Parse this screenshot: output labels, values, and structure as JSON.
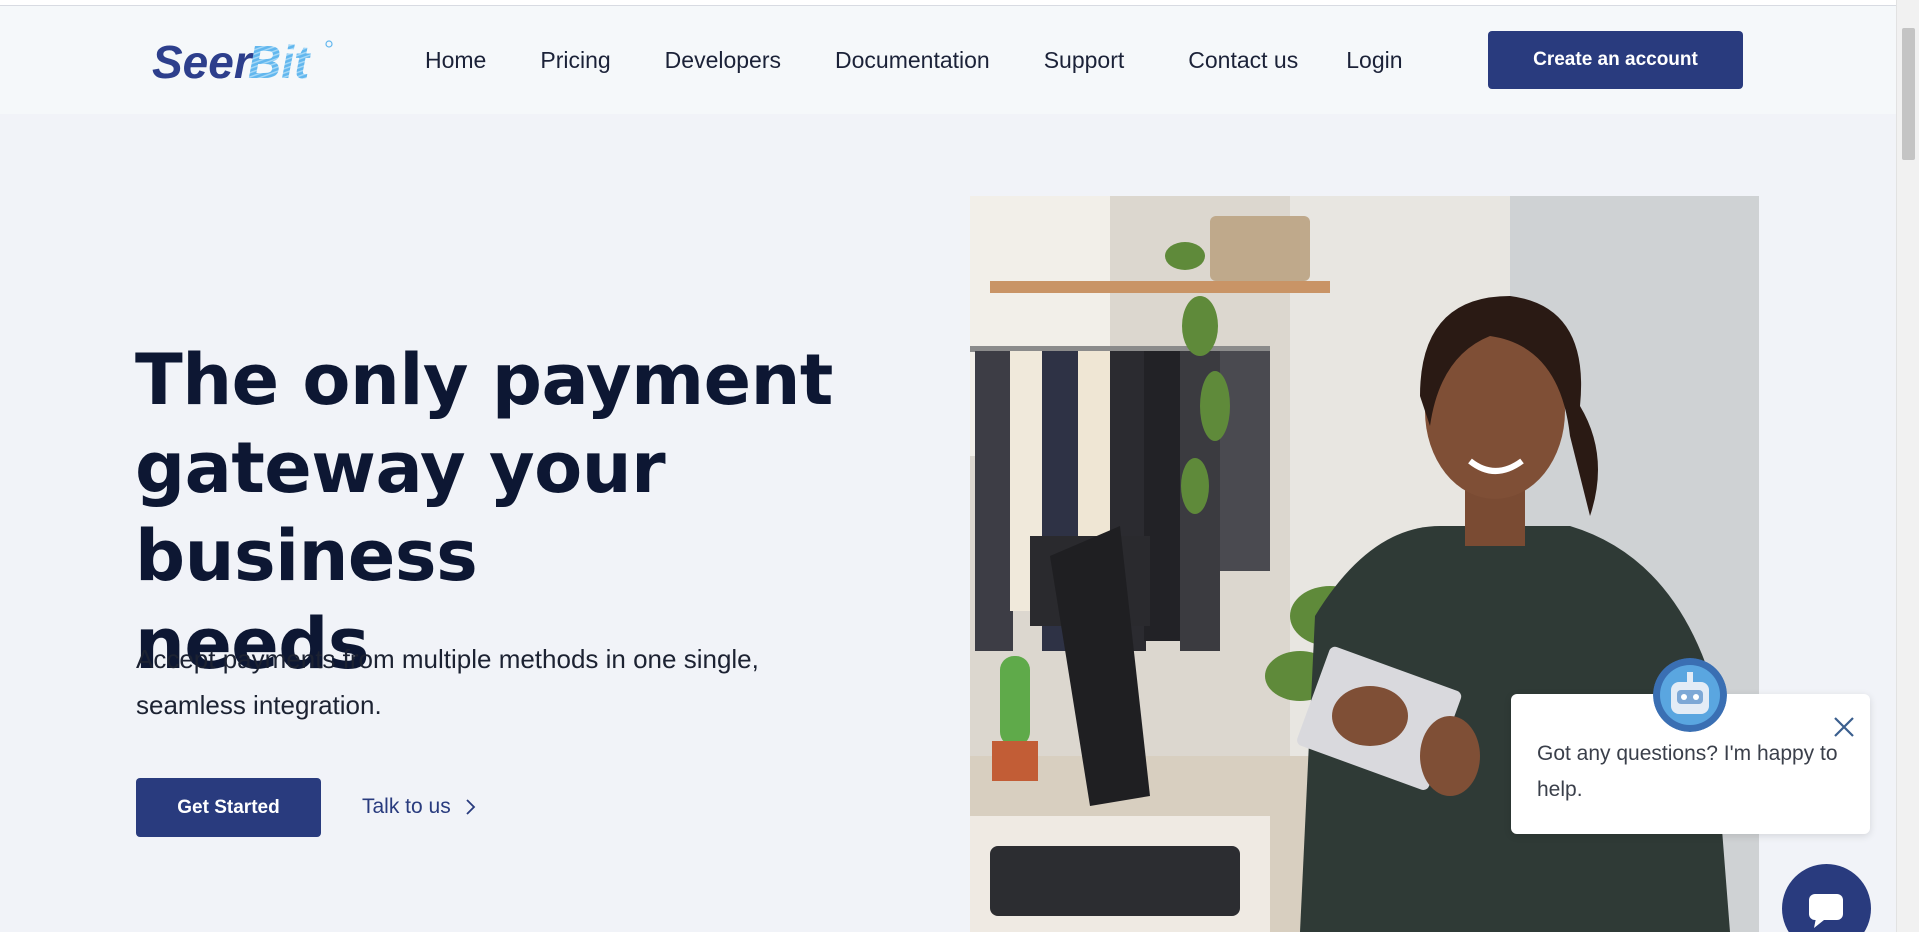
{
  "brand": {
    "logo_text": "SeerBit",
    "colors": {
      "primary": "#293b7e",
      "logo_dark": "#2d3f8c",
      "logo_light": "#62b7ee",
      "heading": "#0d1733"
    }
  },
  "nav": {
    "links": [
      "Home",
      "Pricing",
      "Developers",
      "Documentation",
      "Support",
      "Contact us",
      "Login"
    ],
    "cta": "Create an account"
  },
  "hero": {
    "title_lines": [
      "The only payment",
      "gateway your business",
      "needs"
    ],
    "subtitle_lines": [
      "Accept payments from multiple methods in one single,",
      "seamless integration."
    ],
    "primary_cta": "Get Started",
    "secondary_cta": "Talk to us",
    "secondary_icon": "chevron-right-icon",
    "photo": "woman-holding-tablet-in-clothing-store"
  },
  "chat": {
    "message_lines": [
      "Got any questions? I'm happy to",
      "help."
    ],
    "close_icon": "close-icon",
    "avatar": "robot-avatar",
    "launcher_icon": "chat-bubble-icon"
  }
}
